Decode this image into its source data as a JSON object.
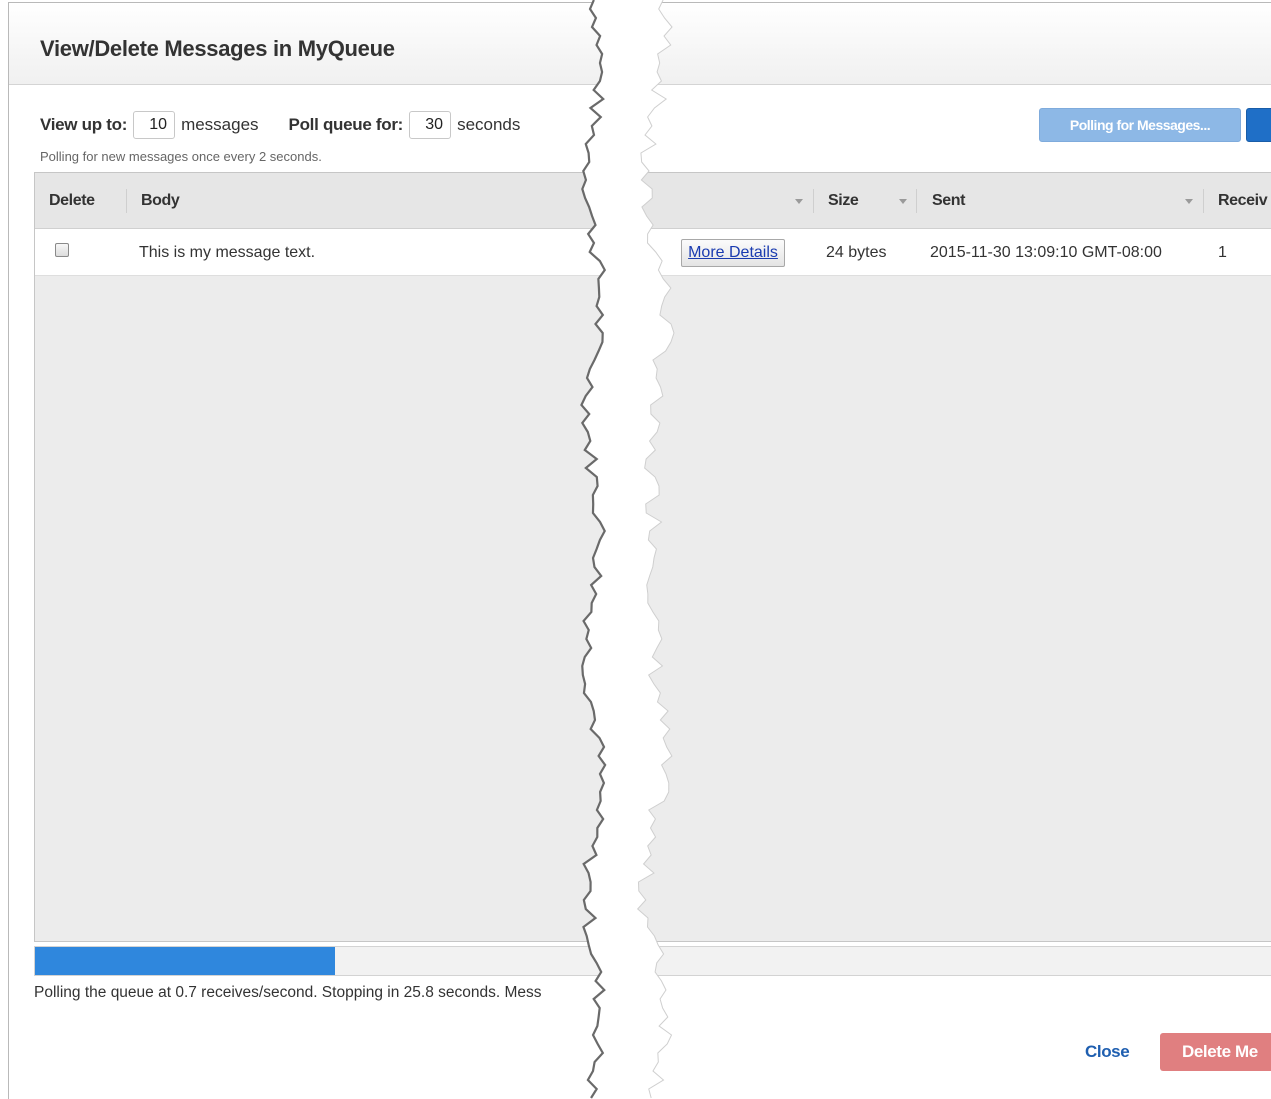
{
  "dialog": {
    "title": "View/Delete Messages in MyQueue"
  },
  "controls": {
    "view_label": "View up to:",
    "view_value": "10",
    "view_unit": "messages",
    "poll_label": "Poll queue for:",
    "poll_value": "30",
    "poll_unit": "seconds",
    "note": "Polling for new messages once every 2 seconds."
  },
  "buttons": {
    "polling": "Polling for Messages...",
    "close": "Close",
    "delete": "Delete Me"
  },
  "table": {
    "columns": [
      "Delete",
      "Body",
      "Size",
      "Sent",
      "Receiv"
    ],
    "rows": [
      {
        "body": "This is my message text.",
        "details": "More Details",
        "size": "24 bytes",
        "sent": "2015-11-30 13:09:10 GMT-08:00",
        "receives": "1",
        "checked": false
      }
    ]
  },
  "progress": {
    "fraction": 0.235
  },
  "status": {
    "text": "Polling the queue at 0.7 receives/second. Stopping in 25.8 seconds. Mess"
  },
  "colors": {
    "accent": "#2f87dd",
    "polling_button": "#8db8e6",
    "delete_button": "#e07f80",
    "link": "#1f5fb0"
  }
}
